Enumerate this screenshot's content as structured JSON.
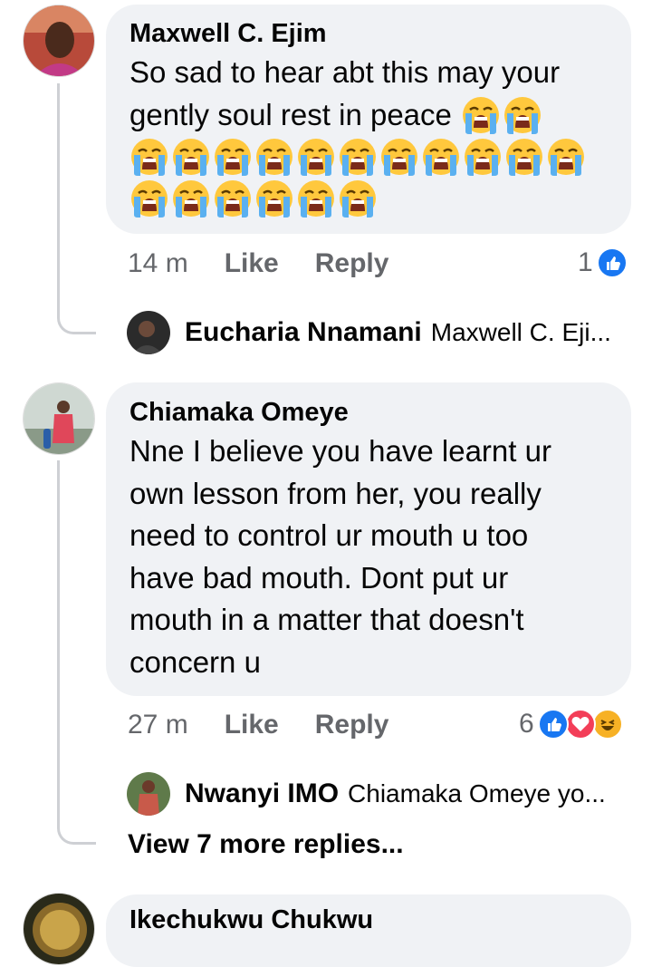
{
  "comments": [
    {
      "author": "Maxwell C. Ejim",
      "text_line1": "So sad to hear abt this may your",
      "text_line2": "gently soul rest in peace",
      "emoji_name": "loudly-crying-face",
      "time": "14 m",
      "like_label": "Like",
      "reply_label": "Reply",
      "reaction_count": "1",
      "reply_preview": {
        "author": "Eucharia Nnamani",
        "text": "Maxwell C. Eji..."
      }
    },
    {
      "author": "Chiamaka Omeye",
      "text_lines": [
        "Nne I believe you have learnt ur",
        "own lesson from her, you really",
        "need to control ur mouth u too",
        "have bad mouth. Dont put ur",
        "mouth in a matter that doesn't",
        "concern u"
      ],
      "time": "27 m",
      "like_label": "Like",
      "reply_label": "Reply",
      "reaction_count": "6",
      "reply_preview": {
        "author": "Nwanyi IMO",
        "text": "Chiamaka Omeye  yo..."
      },
      "view_more": "View 7 more replies..."
    },
    {
      "author": "Ikechukwu Chukwu"
    }
  ],
  "colors": {
    "bubble": "#f0f2f5",
    "meta_text": "#65676b",
    "like_blue": "#1877f2",
    "love_red": "#f33e58",
    "haha_yellow": "#f7b125",
    "thread_line": "#ced0d4"
  }
}
